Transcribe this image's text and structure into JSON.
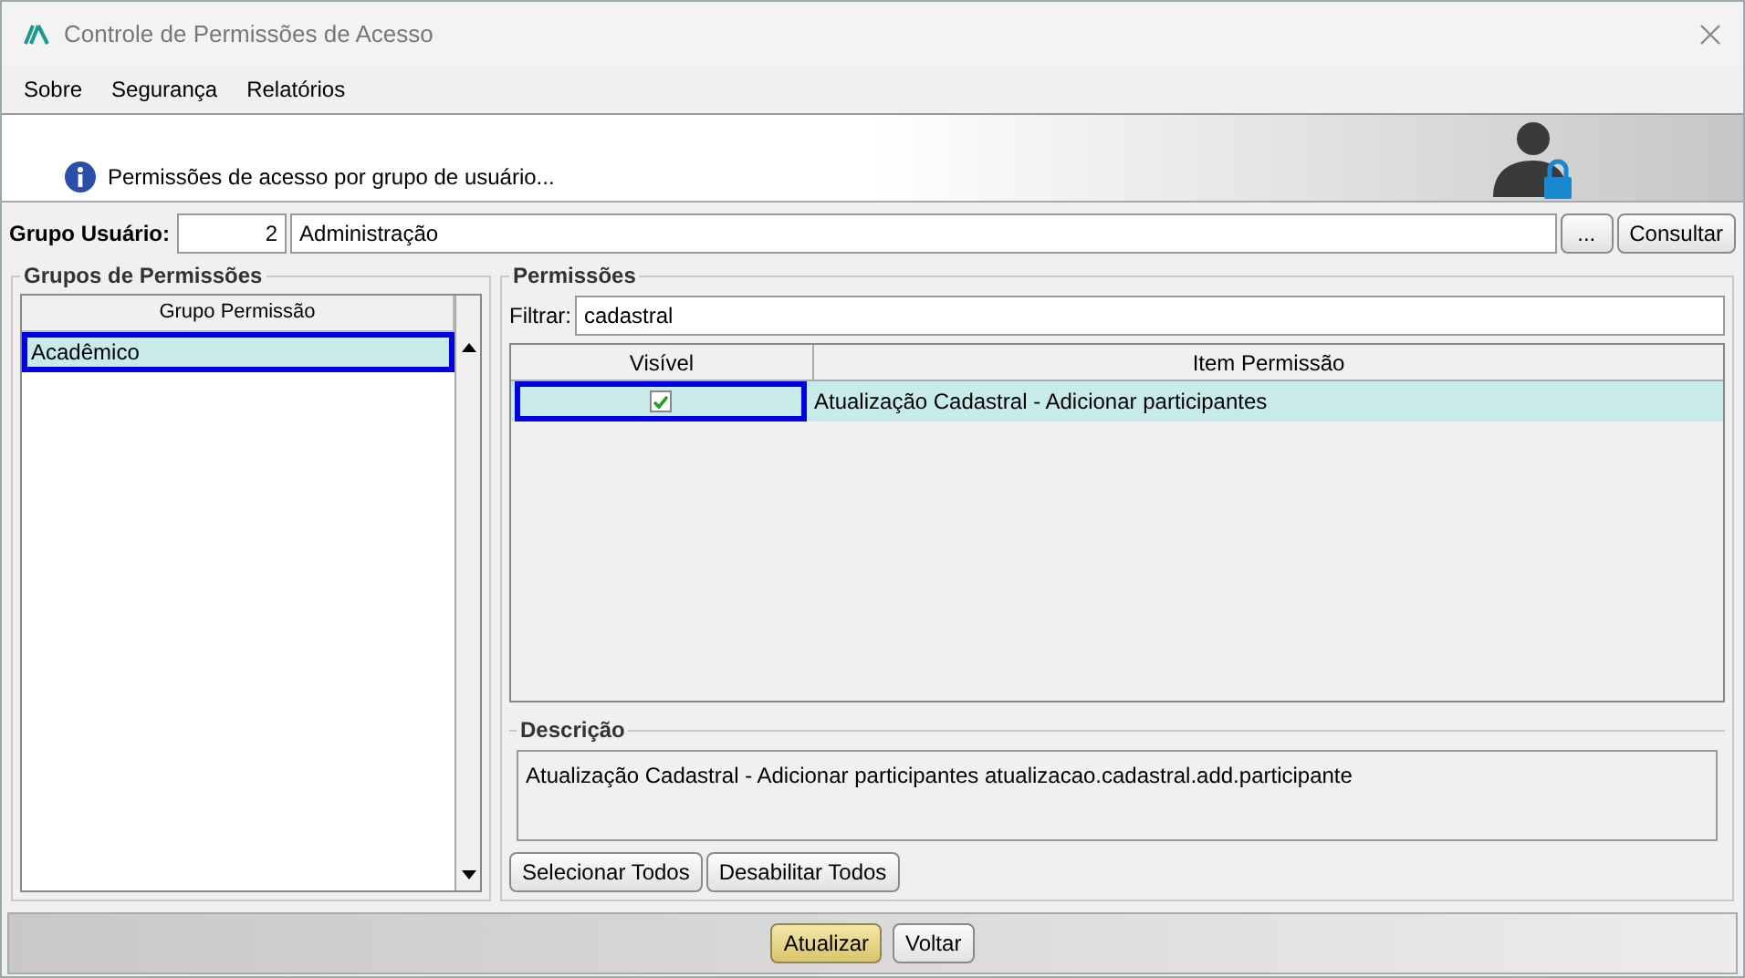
{
  "window": {
    "title": "Controle de Permissões de Acesso"
  },
  "menu": [
    "Sobre",
    "Segurança",
    "Relatórios"
  ],
  "banner": {
    "message": "Permissões de acesso por grupo de usuário..."
  },
  "user_group": {
    "label": "Grupo Usuário:",
    "code": "2",
    "name": "Administração",
    "browse_button": "...",
    "query_button": "Consultar"
  },
  "groups_panel": {
    "title": "Grupos de Permissões",
    "column": "Grupo Permissão",
    "rows": [
      {
        "label": "Acadêmico",
        "selected": true
      }
    ]
  },
  "permissions_panel": {
    "title": "Permissões",
    "filter_label": "Filtrar:",
    "filter_value": "cadastral",
    "columns": [
      "Visível",
      "Item Permissão"
    ],
    "rows": [
      {
        "visible": true,
        "item": "Atualização Cadastral - Adicionar participantes",
        "selected": true
      }
    ]
  },
  "description": {
    "title": "Descrição",
    "text": "Atualização Cadastral - Adicionar participantes atualizacao.cadastral.add.participante"
  },
  "panel_buttons": [
    "Selecionar Todos",
    "Desabilitar Todos"
  ],
  "footer_buttons": [
    {
      "label": "Atualizar",
      "kind": "primary"
    },
    {
      "label": "Voltar",
      "kind": "normal"
    }
  ]
}
